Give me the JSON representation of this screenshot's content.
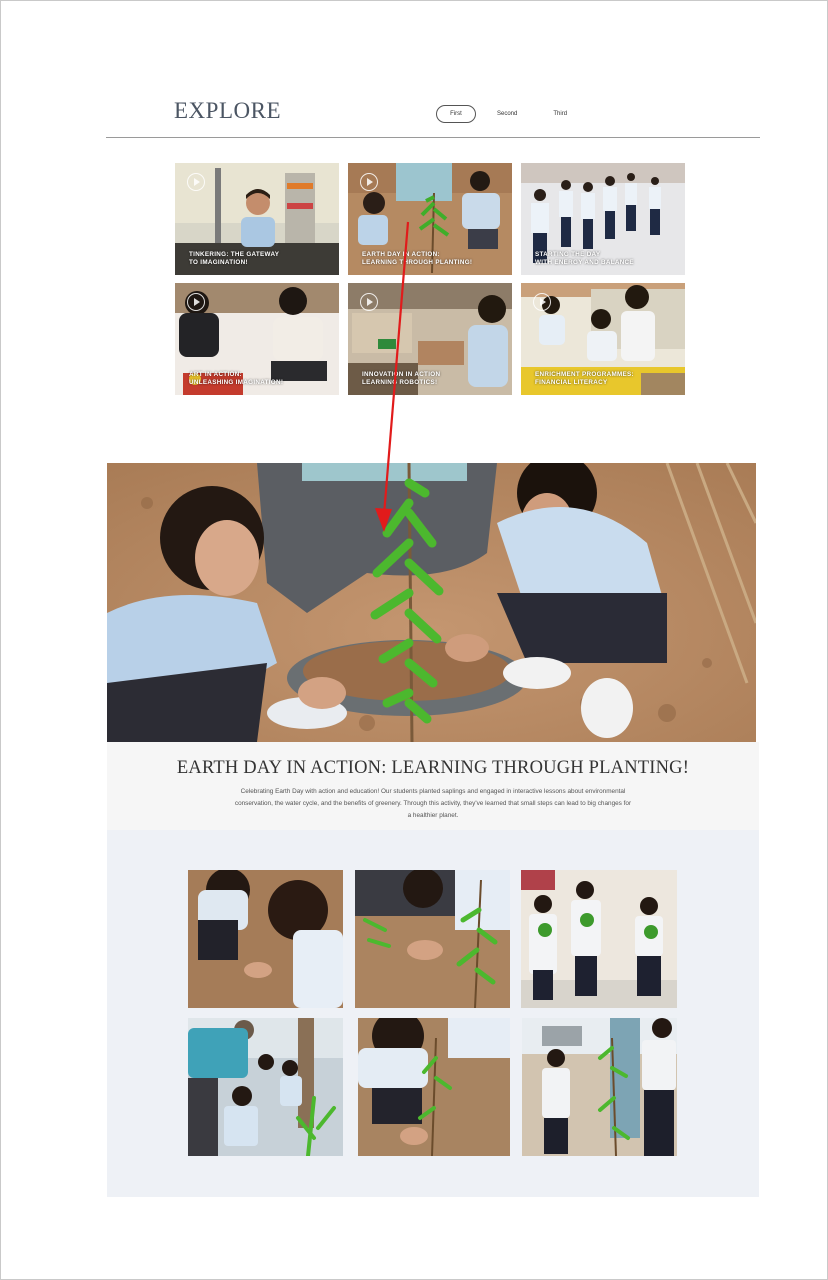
{
  "header": {
    "title": "EXPLORE",
    "tabs": [
      {
        "label": "First",
        "active": true
      },
      {
        "label": "Second",
        "active": false
      },
      {
        "label": "Third",
        "active": false
      }
    ]
  },
  "cards": [
    {
      "line1": "TINKERING: THE GATEWAY",
      "line2": "TO IMAGINATION!",
      "icon": "play-circle-icon"
    },
    {
      "line1": "EARTH DAY IN ACTION:",
      "line2": "LEARNING THROUGH PLANTING!",
      "icon": "play-circle-icon"
    },
    {
      "line1": "STARTING THE DAY",
      "line2": "WITH ENERGY AND BALANCE",
      "icon": "play-circle-icon"
    },
    {
      "line1": "ART IN ACTION:",
      "line2": "UNLEASHING IMAGINATION!",
      "icon": "play-circle-icon"
    },
    {
      "line1": "INNOVATION IN ACTION",
      "line2": "LEARNING ROBOTICS!",
      "icon": "play-circle-icon"
    },
    {
      "line1": "ENRICHMENT PROGRAMMES:",
      "line2": "FINANCIAL LITERACY",
      "icon": "play-circle-icon"
    }
  ],
  "detail": {
    "title": "EARTH DAY IN ACTION: LEARNING THROUGH PLANTING!",
    "description": "Celebrating Earth Day with action and education! Our students planted saplings and engaged in interactive lessons about environmental conservation, the water cycle, and the benefits of greenery. Through this activity, they've learned that small steps can lead to big changes for a healthier planet."
  },
  "colors": {
    "header_rule": "#9a9a9a",
    "detail_bg": "#f6f6f6",
    "gallery_bg": "#eef1f6",
    "annotation_arrow": "#e11b1b"
  }
}
